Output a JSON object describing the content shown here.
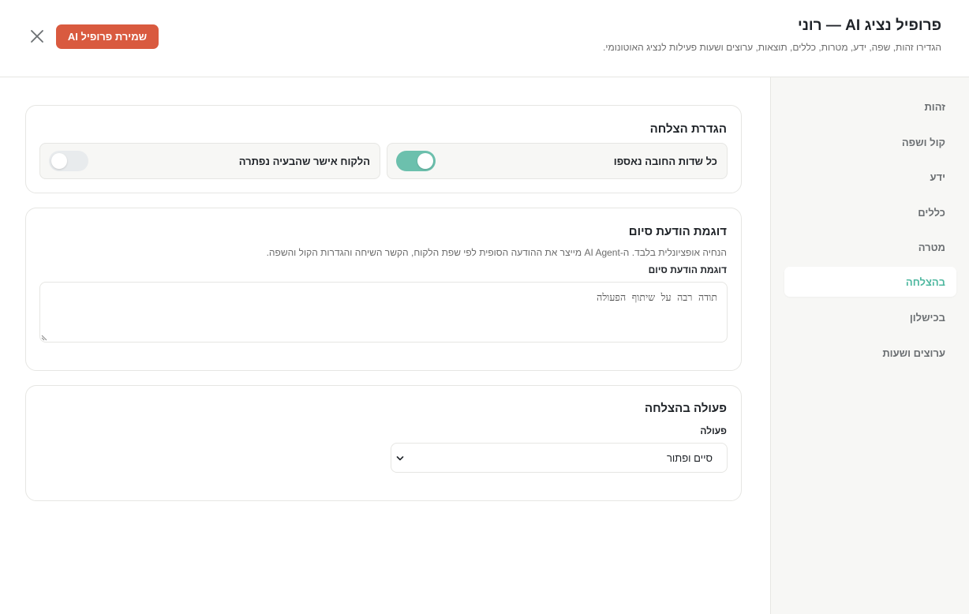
{
  "header": {
    "title": "פרופיל נציג AI — רוני",
    "subtitle": "הגדירו זהות, שפה, ידע, מטרות, כללים, תוצאות, ערוצים ושעות פעילות לנציג האוטונומי.",
    "save_label": "שמירת פרופיל AI"
  },
  "sidebar": {
    "items": [
      {
        "label": "זהות"
      },
      {
        "label": "קול ושפה"
      },
      {
        "label": "ידע"
      },
      {
        "label": "כללים"
      },
      {
        "label": "מטרה"
      },
      {
        "label": "בהצלחה",
        "active": true
      },
      {
        "label": "בכישלון"
      },
      {
        "label": "ערוצים ושעות"
      }
    ]
  },
  "success_definition": {
    "title": "הגדרת הצלחה",
    "toggles": [
      {
        "label": "כל שדות החובה נאספו",
        "on": true
      },
      {
        "label": "הלקוח אישר שהבעיה נפתרה",
        "on": false
      }
    ]
  },
  "closing_message": {
    "title": "דוגמת הודעת סיום",
    "helper": "הנחיה אופציונלית בלבד. ה-AI Agent מייצר את ההודעה הסופית לפי שפת הלקוח, הקשר השיחה והגדרות הקול והשפה.",
    "field_label": "דוגמת הודעת סיום",
    "value": "תודה רבה על שיתוף הפעולה"
  },
  "success_action": {
    "title": "פעולה בהצלחה",
    "field_label": "פעולה",
    "selected": "סיים ופתור"
  },
  "colors": {
    "accent": "#4fb8a0",
    "toggle_on": "#6cc0ad",
    "primary_button": "#d95a3f"
  }
}
